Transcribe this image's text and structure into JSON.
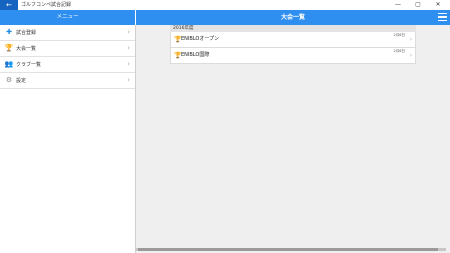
{
  "window": {
    "back_label": "←",
    "title": "ゴルフコンペ試合記録",
    "minimize": "—",
    "maximize": "▢",
    "close": "✕"
  },
  "sidebar": {
    "header": "メニュー",
    "items": [
      {
        "label": "試合登録",
        "icon": "plus-icon",
        "glyph": "✚",
        "color": "#1e88e5"
      },
      {
        "label": "大会一覧",
        "icon": "trophy-icon",
        "glyph": "🏆",
        "color": "#d4a017"
      },
      {
        "label": "クラブ一覧",
        "icon": "group-icon",
        "glyph": "👥",
        "color": "#43a047"
      },
      {
        "label": "設定",
        "icon": "gear-icon",
        "glyph": "⚙",
        "color": "#888888"
      }
    ],
    "chevron": "›"
  },
  "main": {
    "title": "大会一覧",
    "section": "2016年度",
    "rows": [
      {
        "name": "ENIBLOオープン",
        "date": "2月6日",
        "icon": "trophy-icon",
        "icon_color": "#f0b400"
      },
      {
        "name": "ENIBLO国際",
        "date": "2月6日",
        "icon": "trophy-icon",
        "icon_color": "#c47a1a"
      }
    ],
    "chevron": "›"
  }
}
